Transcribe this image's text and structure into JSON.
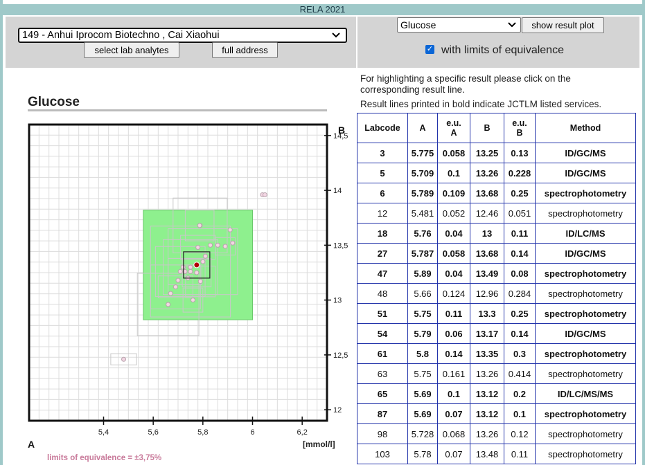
{
  "app_title": "RELA 2021",
  "lab_select": {
    "value": "149 - Anhui Iprocom Biotechno , Cai Xiaohui"
  },
  "buttons": {
    "select_analytes": "select lab analytes",
    "full_address": "full address",
    "show_plot": "show result plot"
  },
  "analyte_select": {
    "value": "Glucose"
  },
  "limits_checkbox": {
    "checked": true,
    "label": "with limits of equivalence"
  },
  "info": {
    "line1": "For highlighting a specific result please click on the",
    "line2": "corresponding result line.",
    "line3": "Result lines printed in bold indicate JCTLM listed services."
  },
  "chart_data": {
    "type": "scatter",
    "title": "Glucose",
    "xlabel": "A",
    "ylabel": "B",
    "x_unit": "[mmol/l]",
    "xlim": [
      5.1,
      6.3
    ],
    "ylim": [
      11.9,
      14.6
    ],
    "x_ticks": [
      "5,4",
      "5,6",
      "5,8",
      "6",
      "6,2"
    ],
    "y_ticks": [
      "14,5",
      "14",
      "13,5",
      "13",
      "12,5",
      "12"
    ],
    "grid": true,
    "highlight_point": {
      "x": 5.775,
      "y": 13.32
    },
    "equivalence_box": {
      "x0": 5.56,
      "x1": 6.0,
      "y0": 12.82,
      "y1": 13.82
    },
    "footnote": "limits of equivalence = ±3,75%",
    "points": [
      {
        "x": 5.775,
        "y": 13.25
      },
      {
        "x": 5.709,
        "y": 13.26
      },
      {
        "x": 5.789,
        "y": 13.68
      },
      {
        "x": 5.481,
        "y": 12.46
      },
      {
        "x": 5.76,
        "y": 13.0
      },
      {
        "x": 5.787,
        "y": 13.68
      },
      {
        "x": 5.89,
        "y": 13.49
      },
      {
        "x": 5.66,
        "y": 12.96
      },
      {
        "x": 5.75,
        "y": 13.3
      },
      {
        "x": 5.79,
        "y": 13.17
      },
      {
        "x": 5.8,
        "y": 13.35
      },
      {
        "x": 5.75,
        "y": 13.26
      },
      {
        "x": 5.69,
        "y": 13.12
      },
      {
        "x": 5.728,
        "y": 13.26
      },
      {
        "x": 5.78,
        "y": 13.48
      },
      {
        "x": 5.74,
        "y": 13.2
      },
      {
        "x": 5.83,
        "y": 13.5
      },
      {
        "x": 5.86,
        "y": 13.5
      },
      {
        "x": 5.92,
        "y": 13.52
      },
      {
        "x": 5.91,
        "y": 13.64
      },
      {
        "x": 5.72,
        "y": 13.3
      },
      {
        "x": 5.67,
        "y": 13.06
      },
      {
        "x": 5.7,
        "y": 13.18
      },
      {
        "x": 5.81,
        "y": 13.4
      },
      {
        "x": 6.04,
        "y": 13.96
      },
      {
        "x": 6.05,
        "y": 13.96
      }
    ]
  },
  "table": {
    "headers": [
      "Labcode",
      "A",
      "e.u. A",
      "B",
      "e.u. B",
      "Method"
    ],
    "rows": [
      {
        "bold": true,
        "cells": [
          "3",
          "5.775",
          "0.058",
          "13.25",
          "0.13",
          "ID/GC/MS"
        ]
      },
      {
        "bold": true,
        "cells": [
          "5",
          "5.709",
          "0.1",
          "13.26",
          "0.228",
          "ID/GC/MS"
        ]
      },
      {
        "bold": true,
        "cells": [
          "6",
          "5.789",
          "0.109",
          "13.68",
          "0.25",
          "spectrophotometry"
        ]
      },
      {
        "bold": false,
        "cells": [
          "12",
          "5.481",
          "0.052",
          "12.46",
          "0.051",
          "spectrophotometry"
        ]
      },
      {
        "bold": true,
        "cells": [
          "18",
          "5.76",
          "0.04",
          "13",
          "0.11",
          "ID/LC/MS"
        ]
      },
      {
        "bold": true,
        "cells": [
          "27",
          "5.787",
          "0.058",
          "13.68",
          "0.14",
          "ID/GC/MS"
        ]
      },
      {
        "bold": true,
        "cells": [
          "47",
          "5.89",
          "0.04",
          "13.49",
          "0.08",
          "spectrophotometry"
        ]
      },
      {
        "bold": false,
        "cells": [
          "48",
          "5.66",
          "0.124",
          "12.96",
          "0.284",
          "spectrophotometry"
        ]
      },
      {
        "bold": true,
        "cells": [
          "51",
          "5.75",
          "0.11",
          "13.3",
          "0.25",
          "spectrophotometry"
        ]
      },
      {
        "bold": true,
        "cells": [
          "54",
          "5.79",
          "0.06",
          "13.17",
          "0.14",
          "ID/GC/MS"
        ]
      },
      {
        "bold": true,
        "cells": [
          "61",
          "5.8",
          "0.14",
          "13.35",
          "0.3",
          "spectrophotometry"
        ]
      },
      {
        "bold": false,
        "cells": [
          "63",
          "5.75",
          "0.161",
          "13.26",
          "0.414",
          "spectrophotometry"
        ]
      },
      {
        "bold": true,
        "cells": [
          "65",
          "5.69",
          "0.1",
          "13.12",
          "0.2",
          "ID/LC/MS/MS"
        ]
      },
      {
        "bold": true,
        "cells": [
          "87",
          "5.69",
          "0.07",
          "13.12",
          "0.1",
          "spectrophotometry"
        ]
      },
      {
        "bold": false,
        "cells": [
          "98",
          "5.728",
          "0.068",
          "13.26",
          "0.12",
          "spectrophotometry"
        ]
      },
      {
        "bold": false,
        "cells": [
          "103",
          "5.78",
          "0.07",
          "13.48",
          "0.11",
          "spectrophotometry"
        ]
      }
    ]
  }
}
